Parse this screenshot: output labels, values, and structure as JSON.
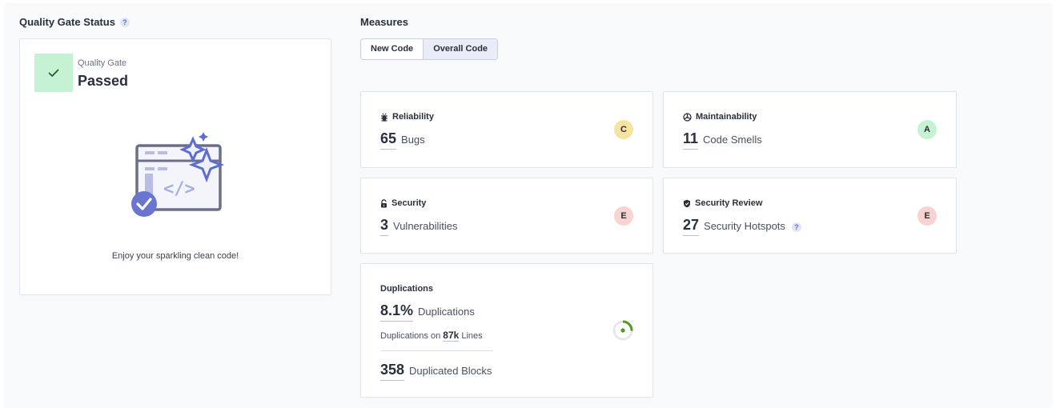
{
  "quality_gate": {
    "section_title": "Quality Gate Status",
    "help": "?",
    "label": "Quality Gate",
    "status": "Passed",
    "message": "Enjoy your sparkling clean code!"
  },
  "measures": {
    "section_title": "Measures",
    "tabs": [
      {
        "label": "New Code",
        "active": false
      },
      {
        "label": "Overall Code",
        "active": true
      }
    ],
    "reliability": {
      "title": "Reliability",
      "value": "65",
      "unit": "Bugs",
      "rating": "C",
      "rating_color": "#f4e4a0"
    },
    "maintainability": {
      "title": "Maintainability",
      "value": "11",
      "unit": "Code Smells",
      "rating": "A",
      "rating_color": "#c6f2d4"
    },
    "security": {
      "title": "Security",
      "value": "3",
      "unit": "Vulnerabilities",
      "rating": "E",
      "rating_color": "#f8d3d0"
    },
    "security_review": {
      "title": "Security Review",
      "value": "27",
      "unit": "Security Hotspots",
      "help": "?",
      "rating": "E",
      "rating_color": "#f8d3d0"
    },
    "duplications": {
      "title": "Duplications",
      "value": "8.1%",
      "unit": "Duplications",
      "lines_prefix": "Duplications on",
      "lines_value": "87k",
      "lines_suffix": "Lines",
      "blocks_value": "358",
      "blocks_unit": "Duplicated Blocks",
      "percent": 8.1
    }
  },
  "colors": {
    "accent": "#5d6cd0",
    "passed_bg": "#c6f2d4",
    "good_green": "#4c9d1b"
  }
}
